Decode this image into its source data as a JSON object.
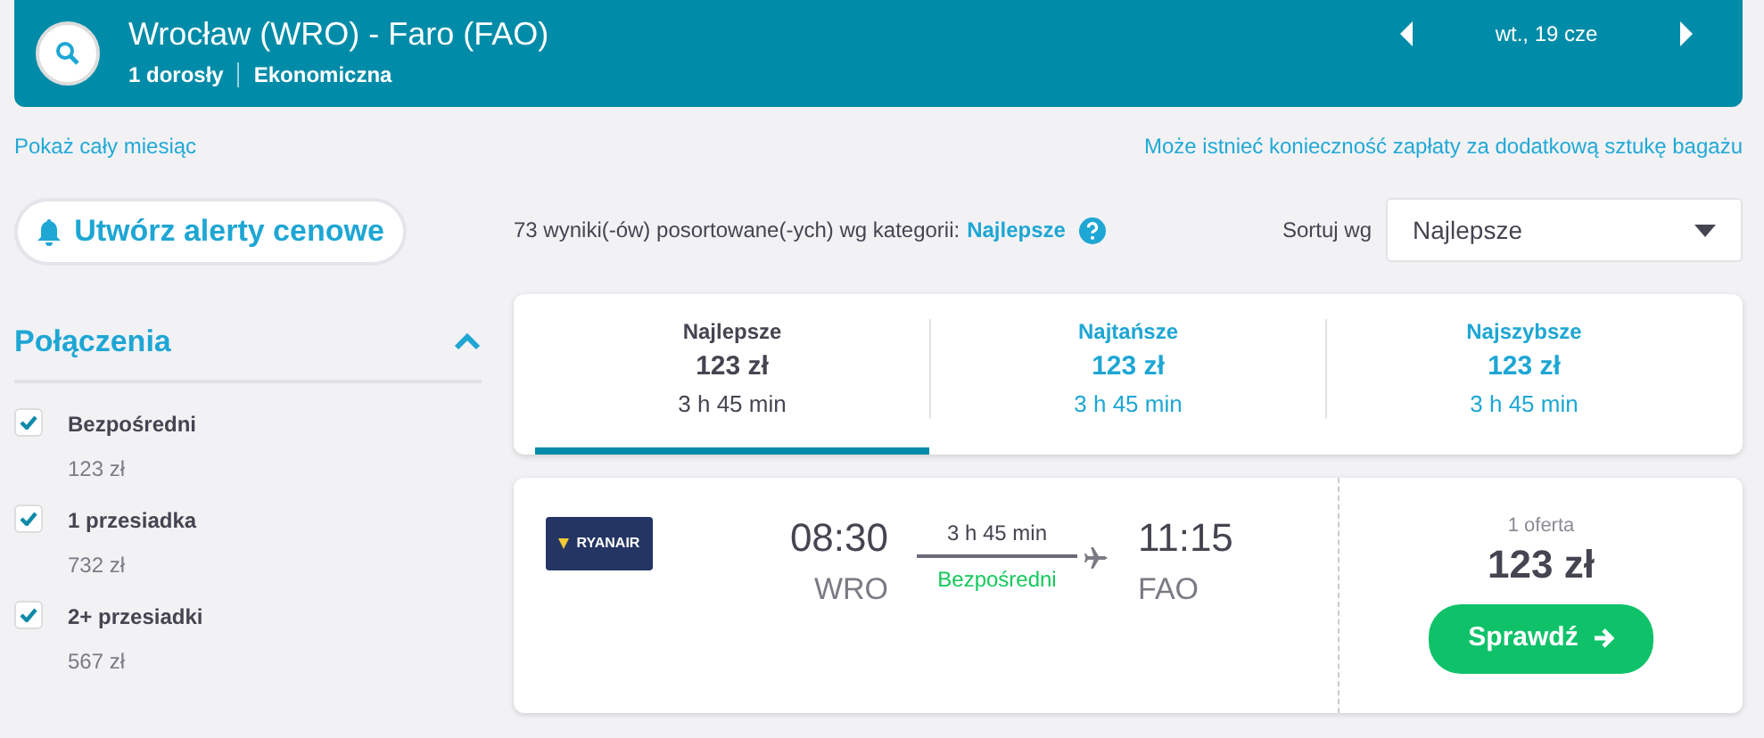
{
  "header": {
    "route": "Wrocław (WRO) - Faro (FAO)",
    "passengers": "1 dorosły",
    "cabin": "Ekonomiczna",
    "date": "wt., 19 cze"
  },
  "links": {
    "month": "Pokaż cały miesiąc",
    "baggage": "Może istnieć konieczność zapłaty za dodatkową sztukę bagażu"
  },
  "alert_button": "Utwórz alerty cenowe",
  "results": {
    "summary": "73 wyniki(-ów) posortowane(-ych) wg kategorii:",
    "category": "Najlepsze",
    "sort_label": "Sortuj wg",
    "sort_value": "Najlepsze"
  },
  "filters": {
    "title": "Połączenia",
    "expanded": true,
    "items": [
      {
        "label": "Bezpośredni",
        "price": "123 zł",
        "checked": true
      },
      {
        "label": "1 przesiadka",
        "price": "732 zł",
        "checked": true
      },
      {
        "label": "2+ przesiadki",
        "price": "567 zł",
        "checked": true
      }
    ]
  },
  "tabs": [
    {
      "label": "Najlepsze",
      "price": "123 zł",
      "duration": "3 h 45 min",
      "selected": true
    },
    {
      "label": "Najtańsze",
      "price": "123 zł",
      "duration": "3 h 45 min",
      "selected": false
    },
    {
      "label": "Najszybsze",
      "price": "123 zł",
      "duration": "3 h 45 min",
      "selected": false
    }
  ],
  "flight": {
    "airline_logo": "RYANAIR",
    "depart_time": "08:30",
    "depart_code": "WRO",
    "duration": "3 h 45 min",
    "stops": "Bezpośredni",
    "arrive_time": "11:15",
    "arrive_code": "FAO",
    "offers": "1 oferta",
    "price": "123 zł",
    "button": "Sprawdź"
  }
}
